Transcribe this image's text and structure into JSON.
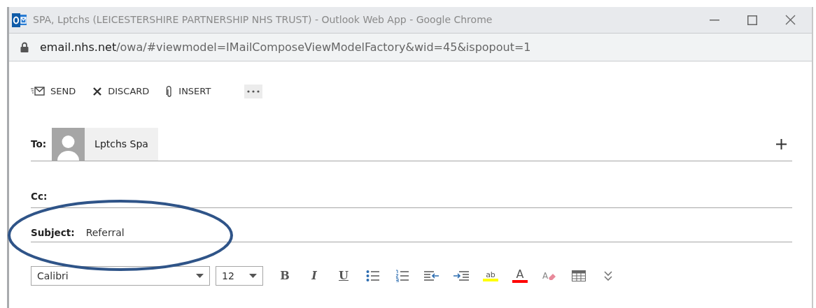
{
  "window": {
    "title": "SPA, Lptchs (LEICESTERSHIRE PARTNERSHIP NHS TRUST) - Outlook Web App - Google Chrome"
  },
  "address_bar": {
    "domain": "email.nhs.net",
    "path": "/owa/#viewmodel=IMailComposeViewModelFactory&wid=45&ispopout=1"
  },
  "toolbar": {
    "actions": [
      {
        "kind": "send",
        "label": "SEND"
      },
      {
        "kind": "discard",
        "label": "DISCARD"
      },
      {
        "kind": "insert",
        "label": "INSERT"
      }
    ]
  },
  "to": {
    "label": "To:",
    "recipients": [
      {
        "name": "Lptchs Spa"
      }
    ]
  },
  "cc": {
    "label": "Cc:"
  },
  "subject": {
    "label": "Subject:",
    "value": "Referral"
  },
  "format_bar": {
    "font": "Calibri",
    "size": "12",
    "tools": [
      {
        "kind": "bold",
        "label": "B"
      },
      {
        "kind": "italic",
        "label": "I"
      },
      {
        "kind": "underline",
        "label": "U"
      },
      {
        "kind": "bullets"
      },
      {
        "kind": "numbering"
      },
      {
        "kind": "outdent"
      },
      {
        "kind": "indent"
      },
      {
        "kind": "highlight",
        "label": "ab"
      },
      {
        "kind": "font_color",
        "label": "A"
      },
      {
        "kind": "clear_format",
        "label": "A"
      },
      {
        "kind": "table"
      },
      {
        "kind": "more"
      }
    ]
  }
}
